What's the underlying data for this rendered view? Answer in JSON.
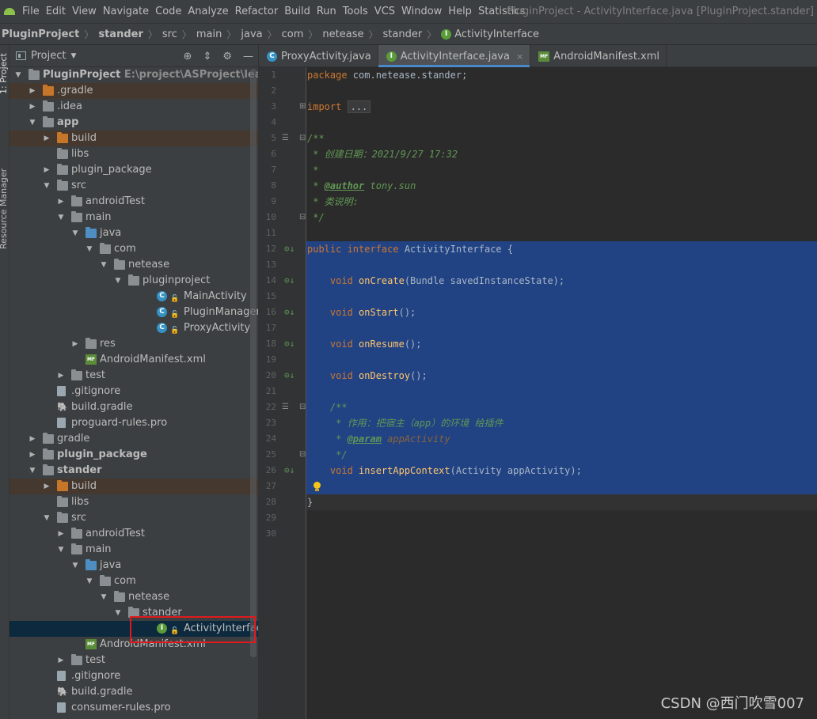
{
  "menubar": {
    "items": [
      "File",
      "Edit",
      "View",
      "Navigate",
      "Code",
      "Analyze",
      "Refactor",
      "Build",
      "Run",
      "Tools",
      "VCS",
      "Window",
      "Help",
      "Statistics"
    ],
    "window_title": "PluginProject - ActivityInterface.java [PluginProject.stander]"
  },
  "breadcrumb": [
    "PluginProject",
    "stander",
    "src",
    "main",
    "java",
    "com",
    "netease",
    "stander",
    "ActivityInterface"
  ],
  "left_strip": {
    "project_tab": "1: Project",
    "resource_tab": "Resource Manager"
  },
  "project_panel": {
    "title": "Project",
    "root_path": "E:\\project\\ASProject\\learningPro",
    "tree": [
      {
        "label": "PluginProject",
        "type": "module",
        "arrow": "down",
        "bold": true
      },
      {
        "label": ".gradle",
        "type": "folder-orange",
        "arrow": "right"
      },
      {
        "label": ".idea",
        "type": "folder",
        "arrow": "right"
      },
      {
        "label": "app",
        "type": "module",
        "arrow": "down",
        "bold": true
      },
      {
        "label": "build",
        "type": "folder-orange",
        "arrow": "right"
      },
      {
        "label": "libs",
        "type": "folder",
        "arrow": "none"
      },
      {
        "label": "plugin_package",
        "type": "folder",
        "arrow": "right"
      },
      {
        "label": "src",
        "type": "folder",
        "arrow": "down"
      },
      {
        "label": "androidTest",
        "type": "folder",
        "arrow": "right"
      },
      {
        "label": "main",
        "type": "folder",
        "arrow": "down"
      },
      {
        "label": "java",
        "type": "folder-blue",
        "arrow": "down"
      },
      {
        "label": "com",
        "type": "package",
        "arrow": "down"
      },
      {
        "label": "netease",
        "type": "package",
        "arrow": "down"
      },
      {
        "label": "pluginproject",
        "type": "package",
        "arrow": "down"
      },
      {
        "label": "MainActivity",
        "type": "class",
        "arrow": "none"
      },
      {
        "label": "PluginManager",
        "type": "class",
        "arrow": "none"
      },
      {
        "label": "ProxyActivity",
        "type": "class",
        "arrow": "none"
      },
      {
        "label": "res",
        "type": "folder",
        "arrow": "right"
      },
      {
        "label": "AndroidManifest.xml",
        "type": "manifest",
        "arrow": "none"
      },
      {
        "label": "test",
        "type": "folder",
        "arrow": "right"
      },
      {
        "label": ".gitignore",
        "type": "file",
        "arrow": "none"
      },
      {
        "label": "build.gradle",
        "type": "gradle",
        "arrow": "none"
      },
      {
        "label": "proguard-rules.pro",
        "type": "file",
        "arrow": "none"
      },
      {
        "label": "gradle",
        "type": "folder",
        "arrow": "right"
      },
      {
        "label": "plugin_package",
        "type": "module",
        "arrow": "right",
        "bold": true
      },
      {
        "label": "stander",
        "type": "module",
        "arrow": "down",
        "bold": true
      },
      {
        "label": "build",
        "type": "folder-orange",
        "arrow": "right"
      },
      {
        "label": "libs",
        "type": "folder",
        "arrow": "none"
      },
      {
        "label": "src",
        "type": "folder",
        "arrow": "down"
      },
      {
        "label": "androidTest",
        "type": "folder",
        "arrow": "right"
      },
      {
        "label": "main",
        "type": "folder",
        "arrow": "down"
      },
      {
        "label": "java",
        "type": "folder-blue",
        "arrow": "down"
      },
      {
        "label": "com",
        "type": "package",
        "arrow": "down"
      },
      {
        "label": "netease",
        "type": "package",
        "arrow": "down"
      },
      {
        "label": "stander",
        "type": "package",
        "arrow": "down"
      },
      {
        "label": "ActivityInterface",
        "type": "interface",
        "arrow": "none",
        "selected": true
      },
      {
        "label": "AndroidManifest.xml",
        "type": "manifest",
        "arrow": "none"
      },
      {
        "label": "test",
        "type": "folder",
        "arrow": "right"
      },
      {
        "label": ".gitignore",
        "type": "file",
        "arrow": "none"
      },
      {
        "label": "build.gradle",
        "type": "gradle",
        "arrow": "none"
      },
      {
        "label": "consumer-rules.pro",
        "type": "file",
        "arrow": "none"
      }
    ]
  },
  "editor": {
    "tabs": [
      {
        "label": "ProxyActivity.java",
        "icon": "class-icon",
        "active": false
      },
      {
        "label": "ActivityInterface.java",
        "icon": "interface-icon",
        "active": true
      },
      {
        "label": "AndroidManifest.xml",
        "icon": "manifest-icon",
        "active": false
      }
    ],
    "close_glyph": "×",
    "code": {
      "package_kw": "package",
      "package_name": " com.netease.stander;",
      "import_kw": "import",
      "import_fold": "...",
      "doc_open": "/**",
      "doc_date": " * 创建日期：2021/9/27 17:32",
      "doc_star": " *",
      "doc_star_prefix": " * ",
      "doc_author_tag": "@author",
      "doc_author_val": " tony.sun",
      "doc_desc": " * 类说明:",
      "doc_close": " */",
      "iface_kw": "public interface",
      "iface_name": " ActivityInterface {",
      "void_kw": "    void ",
      "m1_name": "onCreate",
      "m1_args": "(Bundle savedInstanceState);",
      "m2_name": "onStart",
      "m3_name": "onResume",
      "m4_name": "onDestroy",
      "empty_args": "();",
      "inner_doc_open": "    /**",
      "inner_doc_purpose": "     * 作用：把宿主（app）的环境 给插件",
      "inner_doc_star_prefix": "     * ",
      "inner_param_tag": "@param",
      "inner_param_val": " appActivity",
      "inner_doc_close": "     */",
      "m5_name": "insertAppContext",
      "m5_args": "(Activity appActivity);",
      "close_brace": "}"
    },
    "line_numbers": [
      1,
      2,
      3,
      4,
      5,
      6,
      7,
      8,
      9,
      10,
      11,
      12,
      13,
      14,
      15,
      16,
      17,
      18,
      19,
      20,
      21,
      22,
      23,
      24,
      25,
      26,
      27,
      28,
      29,
      30
    ]
  },
  "watermark": "CSDN @西门吹雪007"
}
